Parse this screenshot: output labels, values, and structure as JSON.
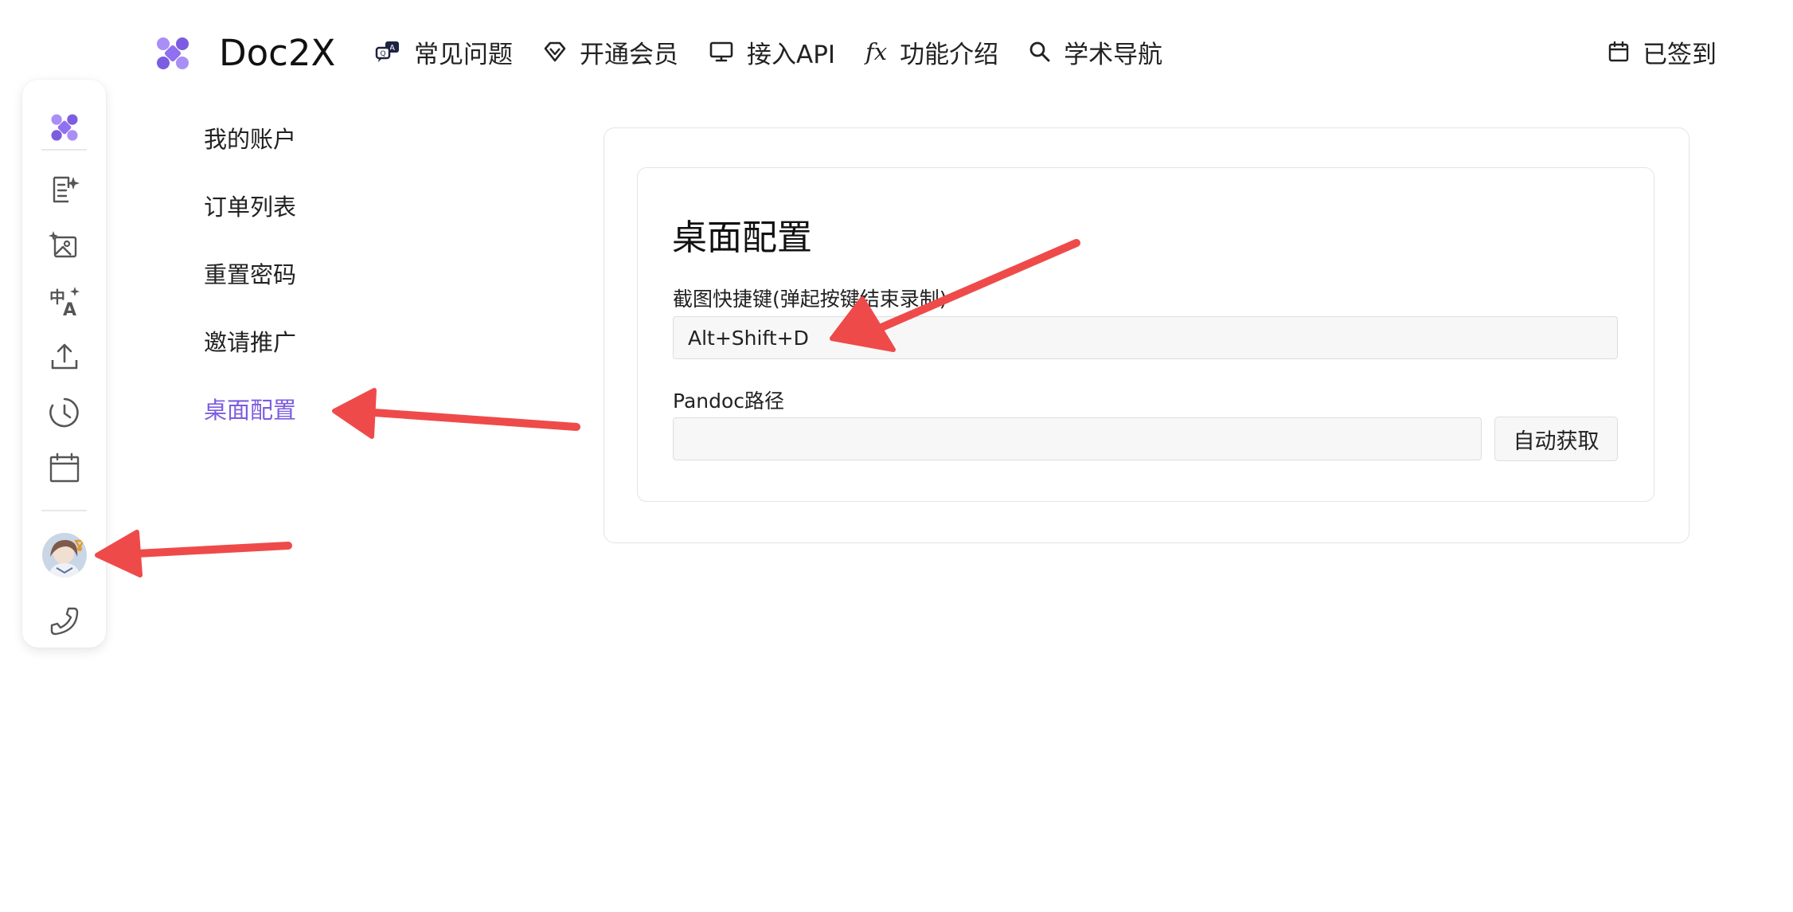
{
  "app": {
    "name": "Doc2X"
  },
  "header": {
    "nav": [
      {
        "label": "常见问题",
        "icon": "faq-chat-icon"
      },
      {
        "label": "开通会员",
        "icon": "diamond-icon"
      },
      {
        "label": "接入API",
        "icon": "monitor-icon"
      },
      {
        "label": "功能介绍",
        "icon": "fx-icon",
        "glyph": "fx"
      },
      {
        "label": "学术导航",
        "icon": "search-icon"
      }
    ],
    "checkin_label": "已签到"
  },
  "rail": {
    "items": [
      "logo-icon",
      "document-sparkle-icon",
      "image-sparkle-icon",
      "translate-icon",
      "upload-icon",
      "history-icon",
      "calendar-icon",
      "avatar",
      "phone-icon"
    ]
  },
  "menu": {
    "items": [
      "我的账户",
      "订单列表",
      "重置密码",
      "邀请推广",
      "桌面配置"
    ],
    "active_index": 4
  },
  "settings": {
    "title": "桌面配置",
    "shortcut_label": "截图快捷键(弹起按键结束录制)",
    "shortcut_value": "Alt+Shift+D",
    "pandoc_label": "Pandoc路径",
    "pandoc_value": "",
    "auto_button": "自动获取"
  },
  "colors": {
    "accent": "#7c5ce0",
    "annotation": "#ef4a4a"
  }
}
